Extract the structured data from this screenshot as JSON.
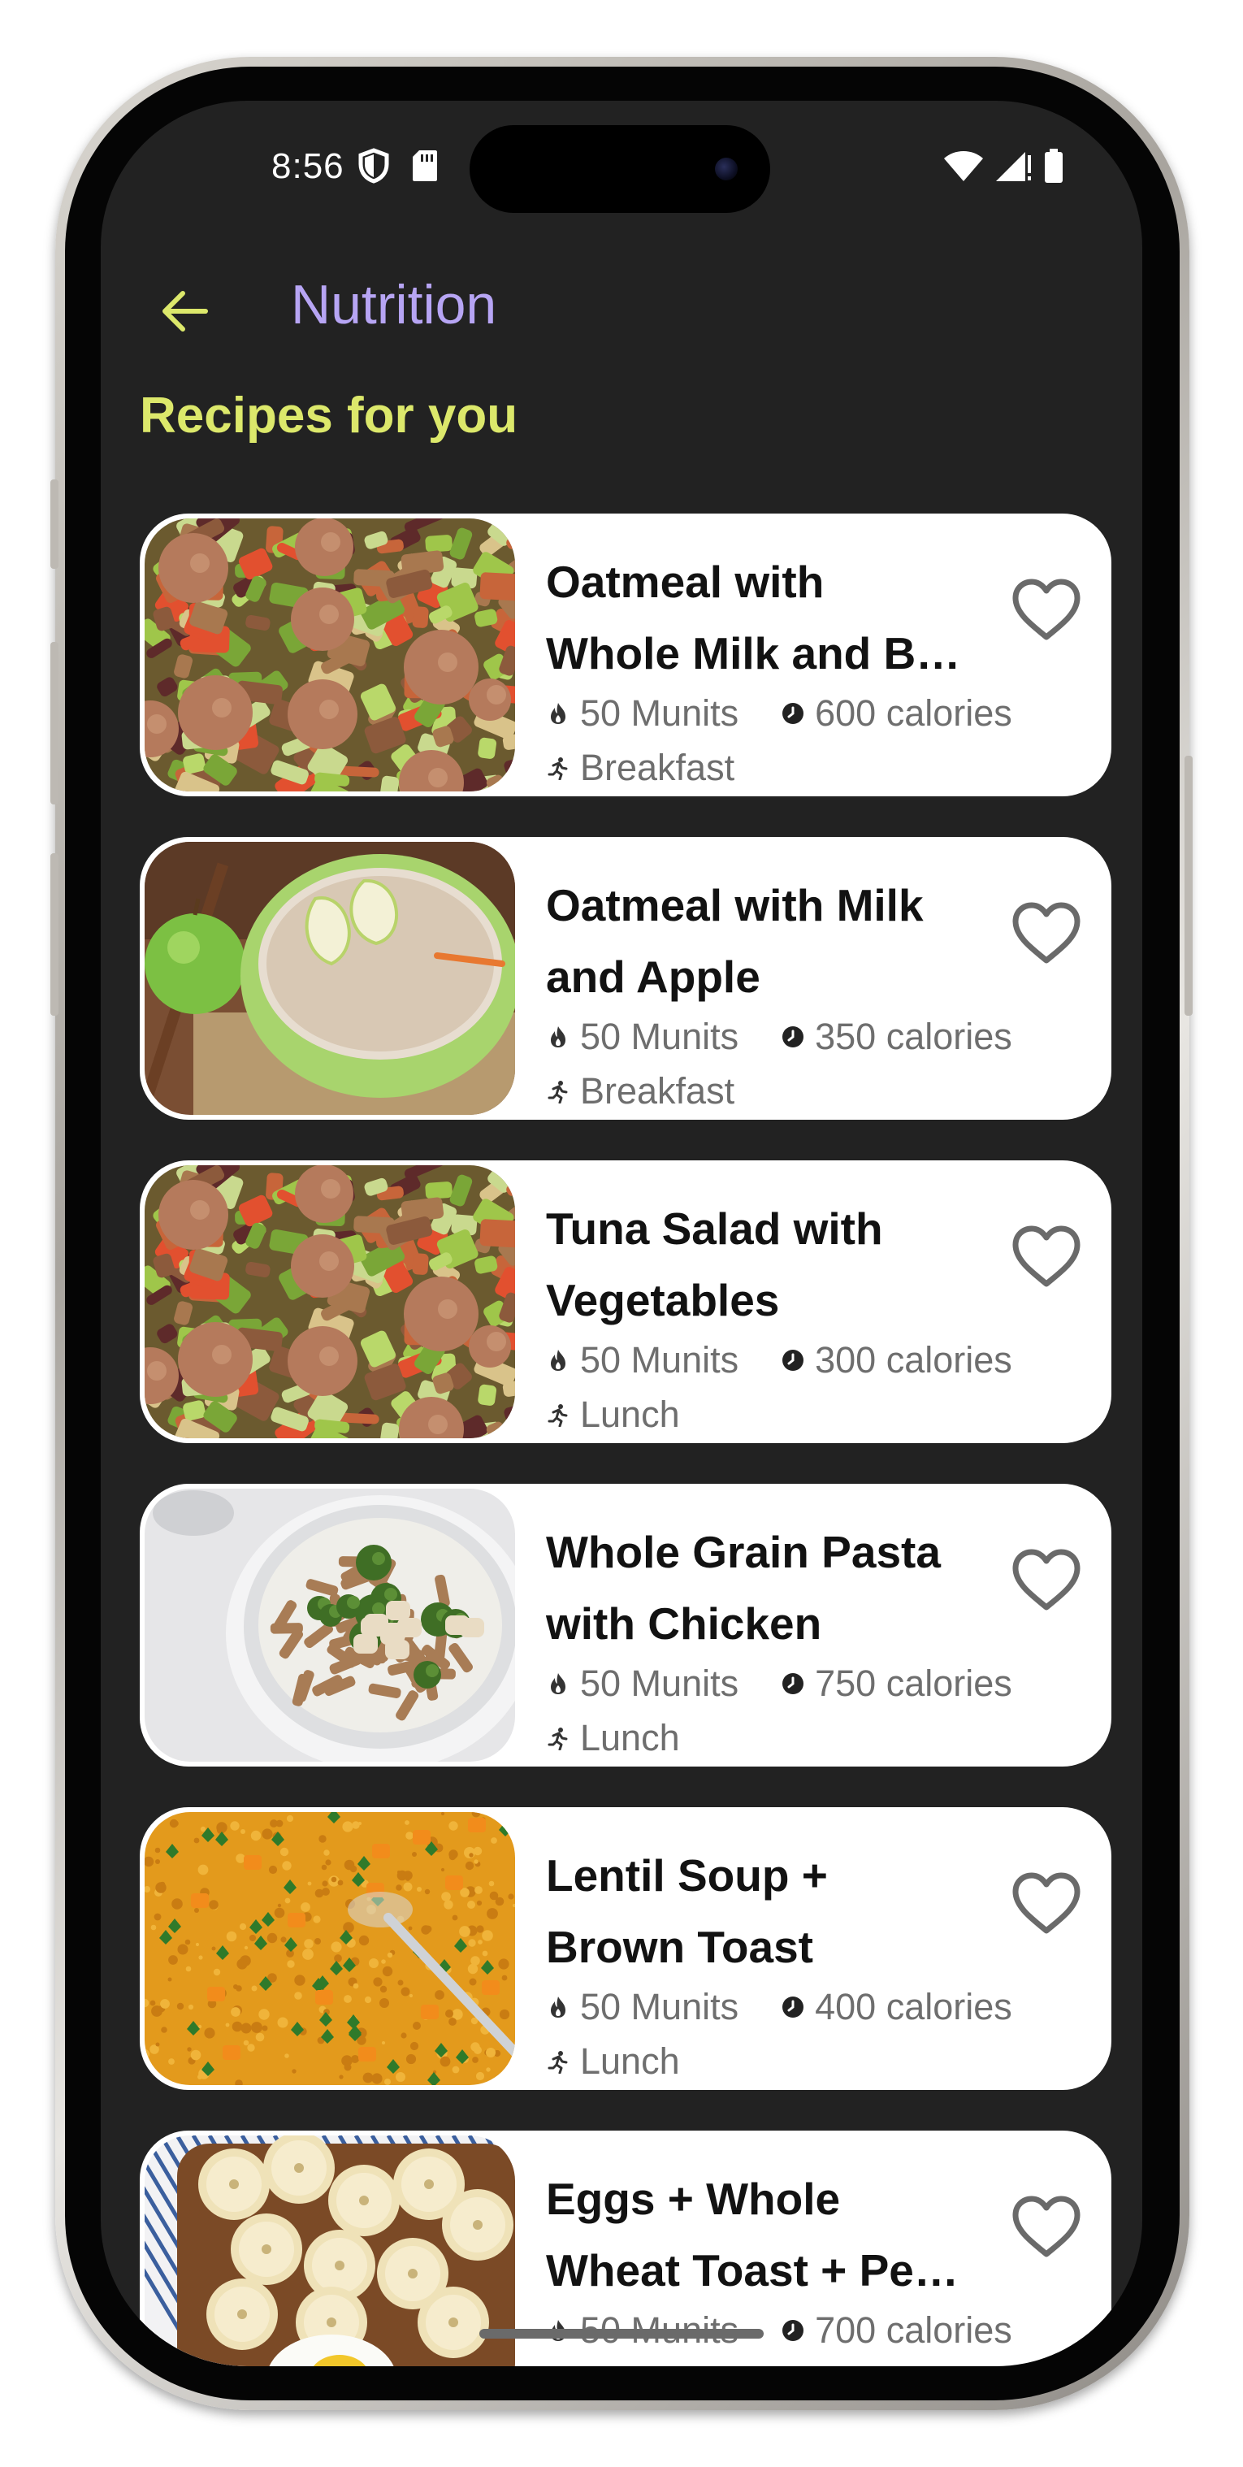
{
  "status_bar": {
    "time": "8:56"
  },
  "header": {
    "title": "Nutrition",
    "back_icon": "arrow-left-icon"
  },
  "section": {
    "title": "Recipes for you"
  },
  "colors": {
    "screen_bg": "#222222",
    "title": "#b7a5f4",
    "accent": "#dce86b",
    "card_bg": "#ffffff"
  },
  "recipes": [
    {
      "title_line1": "Oatmeal with",
      "title_line2": "Whole Milk and B…",
      "munits": "50 Munits",
      "calories": "600 calories",
      "meal": "Breakfast",
      "image": "salad"
    },
    {
      "title_line1": "Oatmeal with Milk",
      "title_line2": "and Apple",
      "munits": "50 Munits",
      "calories": "350 calories",
      "meal": "Breakfast",
      "image": "oatmeal-apple"
    },
    {
      "title_line1": "Tuna Salad with",
      "title_line2": "Vegetables",
      "munits": "50 Munits",
      "calories": "300 calories",
      "meal": "Lunch",
      "image": "salad"
    },
    {
      "title_line1": "Whole Grain Pasta",
      "title_line2": "with Chicken",
      "munits": "50 Munits",
      "calories": "750 calories",
      "meal": "Lunch",
      "image": "pasta"
    },
    {
      "title_line1": "Lentil Soup +",
      "title_line2": "Brown Toast",
      "munits": "50 Munits",
      "calories": "400 calories",
      "meal": "Lunch",
      "image": "lentil-soup"
    },
    {
      "title_line1": "Eggs + Whole",
      "title_line2": "Wheat Toast + Pe…",
      "munits": "50 Munits",
      "calories": "700 calories",
      "meal": "",
      "image": "eggs-banana-toast"
    }
  ]
}
